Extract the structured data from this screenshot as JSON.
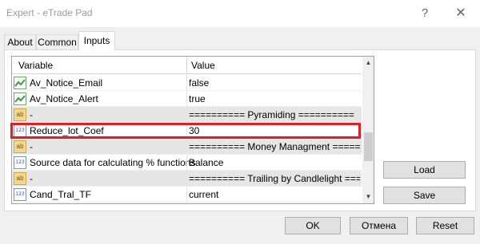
{
  "window": {
    "title": "Expert - eTrade Pad",
    "help_glyph": "?",
    "close_glyph": "✕"
  },
  "tabs": [
    {
      "label": "About"
    },
    {
      "label": "Common"
    },
    {
      "label": "Inputs",
      "active": true
    }
  ],
  "grid": {
    "columns": [
      "Variable",
      "Value"
    ],
    "rows": [
      {
        "icon": "green-chart-icon",
        "icon_text": "",
        "name": "Av_Notice_Email",
        "value": "false"
      },
      {
        "icon": "green-chart-icon",
        "icon_text": "",
        "name": "Av_Notice_Alert",
        "value": "true"
      },
      {
        "icon": "ab-string-icon",
        "icon_text": "ab",
        "name": "-",
        "value": "========== Pyramiding =========="
      },
      {
        "icon": "numeric-123-icon",
        "icon_text": "123",
        "name": "Reduce_lot_Coef",
        "value": "30",
        "highlighted": true
      },
      {
        "icon": "ab-string-icon",
        "icon_text": "ab",
        "name": "-",
        "value": "========== Money Managment ========"
      },
      {
        "icon": "numeric-123-icon",
        "icon_text": "123",
        "name": "Source data for calculating % functions",
        "value": "Balance"
      },
      {
        "icon": "ab-string-icon",
        "icon_text": "ab",
        "name": "-",
        "value": "========== Trailing by Candlelight ====="
      },
      {
        "icon": "numeric-123-icon",
        "icon_text": "123",
        "name": "Cand_Tral_TF",
        "value": "current"
      }
    ],
    "scroll_up_glyph": "▲",
    "scroll_down_glyph": "▼"
  },
  "side_buttons": {
    "load": "Load",
    "save": "Save"
  },
  "footer": {
    "ok": "OK",
    "cancel": "Отмена",
    "reset": "Reset"
  },
  "colors": {
    "highlight": "#e21e24",
    "accent_green": "#6aa56a",
    "numeric_blue": "#2850a0"
  }
}
